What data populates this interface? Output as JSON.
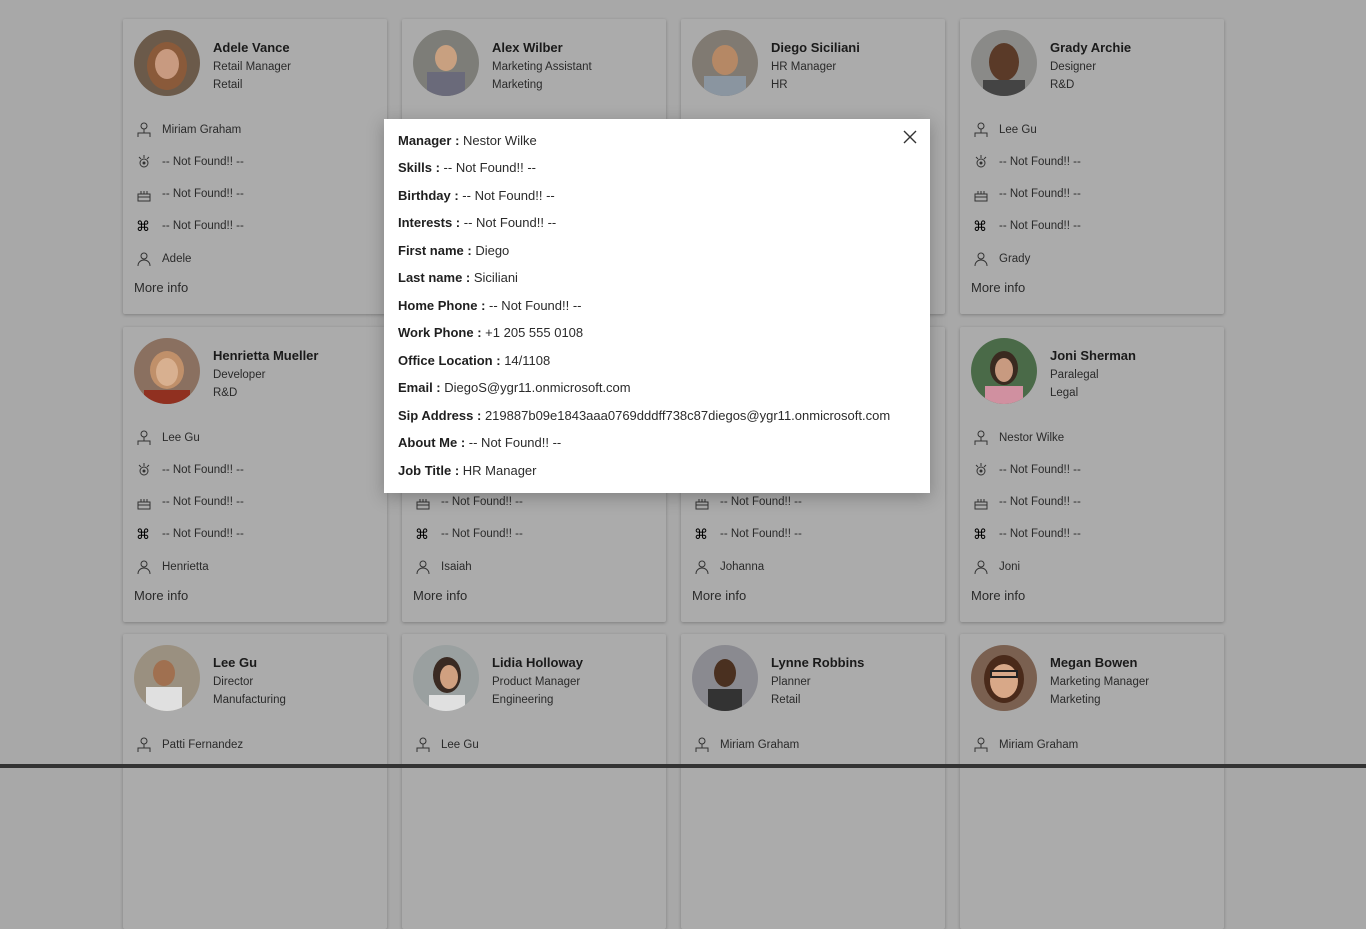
{
  "cards": [
    {
      "name": "Adele Vance",
      "title": "Retail Manager",
      "dept": "Retail",
      "manager": "Miriam Graham",
      "skills": "-- Not Found!! --",
      "birthday": "-- Not Found!! --",
      "interests": "-- Not Found!! --",
      "first_name": "Adele",
      "more": "More info"
    },
    {
      "name": "Alex Wilber",
      "title": "Marketing Assistant",
      "dept": "Marketing",
      "manager": "",
      "skills": "",
      "birthday": "",
      "interests": "",
      "first_name": "",
      "more": ""
    },
    {
      "name": "Diego Siciliani",
      "title": "HR Manager",
      "dept": "HR",
      "manager": "",
      "skills": "",
      "birthday": "",
      "interests": "",
      "first_name": "",
      "more": ""
    },
    {
      "name": "Grady Archie",
      "title": "Designer",
      "dept": "R&D",
      "manager": "Lee Gu",
      "skills": "-- Not Found!! --",
      "birthday": "-- Not Found!! --",
      "interests": "-- Not Found!! --",
      "first_name": "Grady",
      "more": "More info"
    },
    {
      "name": "Henrietta Mueller",
      "title": "Developer",
      "dept": "R&D",
      "manager": "Lee Gu",
      "skills": "-- Not Found!! --",
      "birthday": "-- Not Found!! --",
      "interests": "-- Not Found!! --",
      "first_name": "Henrietta",
      "more": "More info"
    },
    {
      "name": "",
      "title": "",
      "dept": "",
      "manager": "",
      "skills": "",
      "birthday": "-- Not Found!! --",
      "interests": "-- Not Found!! --",
      "first_name": "Isaiah",
      "more": "More info"
    },
    {
      "name": "",
      "title": "",
      "dept": "",
      "manager": "",
      "skills": "",
      "birthday": "-- Not Found!! --",
      "interests": "-- Not Found!! --",
      "first_name": "Johanna",
      "more": "More info"
    },
    {
      "name": "Joni Sherman",
      "title": "Paralegal",
      "dept": "Legal",
      "manager": "Nestor Wilke",
      "skills": "-- Not Found!! --",
      "birthday": "-- Not Found!! --",
      "interests": "-- Not Found!! --",
      "first_name": "Joni",
      "more": "More info"
    },
    {
      "name": "Lee Gu",
      "title": "Director",
      "dept": "Manufacturing",
      "manager": "Patti Fernandez",
      "skills": "",
      "birthday": "",
      "interests": "",
      "first_name": "",
      "more": ""
    },
    {
      "name": "Lidia Holloway",
      "title": "Product Manager",
      "dept": "Engineering",
      "manager": "Lee Gu",
      "skills": "",
      "birthday": "",
      "interests": "",
      "first_name": "",
      "more": ""
    },
    {
      "name": "Lynne Robbins",
      "title": "Planner",
      "dept": "Retail",
      "manager": "Miriam Graham",
      "skills": "",
      "birthday": "",
      "interests": "",
      "first_name": "",
      "more": ""
    },
    {
      "name": "Megan Bowen",
      "title": "Marketing Manager",
      "dept": "Marketing",
      "manager": "Miriam Graham",
      "skills": "",
      "birthday": "",
      "interests": "",
      "first_name": "",
      "more": ""
    }
  ],
  "modal": {
    "fields": [
      {
        "label": "Manager :",
        "value": "Nestor Wilke"
      },
      {
        "label": "Skills :",
        "value": "-- Not Found!! --"
      },
      {
        "label": "Birthday :",
        "value": "-- Not Found!! --"
      },
      {
        "label": "Interests :",
        "value": "-- Not Found!! --"
      },
      {
        "label": "First name :",
        "value": "Diego"
      },
      {
        "label": "Last name :",
        "value": "Siciliani"
      },
      {
        "label": "Home Phone :",
        "value": "-- Not Found!! --"
      },
      {
        "label": "Work Phone :",
        "value": "+1 205 555 0108"
      },
      {
        "label": "Office Location :",
        "value": "14/1108"
      },
      {
        "label": "Email :",
        "value": "DiegoS@ygr11.onmicrosoft.com"
      },
      {
        "label": "Sip Address :",
        "value": "219887b09e1843aaa0769dddff738c87diegos@ygr11.onmicrosoft.com"
      },
      {
        "label": "About Me :",
        "value": "-- Not Found!! --"
      },
      {
        "label": "Job Title :",
        "value": "HR Manager"
      }
    ]
  },
  "icons": {
    "manager": "org-person-icon",
    "skills": "skills-gear-icon",
    "birthday": "birthday-cake-icon",
    "interests": "command-icon",
    "first_name": "person-icon",
    "close": "close-icon"
  },
  "colors": {
    "overlay_bg": "#a8a8a8",
    "card_bg": "#ababab",
    "modal_bg": "#ffffff"
  }
}
